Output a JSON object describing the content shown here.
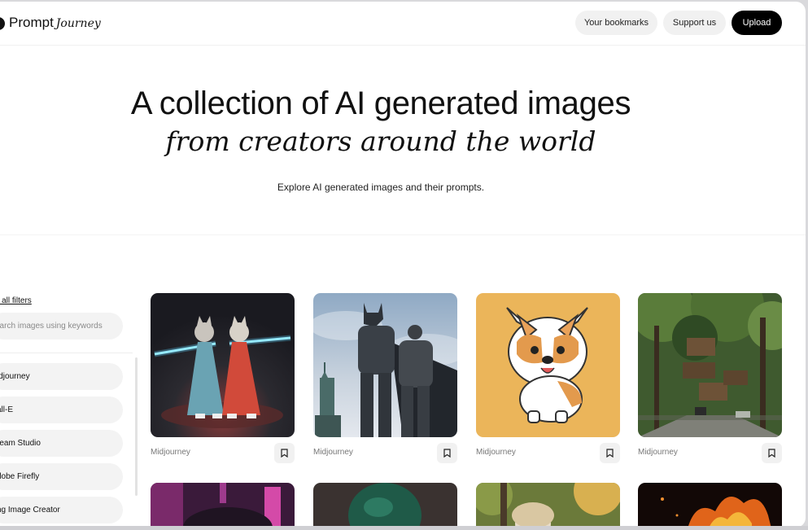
{
  "brand": {
    "name": "Prompt",
    "script": "Journey"
  },
  "nav": {
    "bookmarks": "Your bookmarks",
    "support": "Support us",
    "upload": "Upload"
  },
  "hero": {
    "title": "A collection of AI generated images",
    "subtitle": "from creators around the world",
    "tagline": "Explore AI generated images and their prompts."
  },
  "filters": {
    "clear": "r all filters",
    "search_placeholder": "earch images using keywords",
    "items": [
      {
        "label": "idjourney"
      },
      {
        "label": "all-E"
      },
      {
        "label": "ream Studio"
      },
      {
        "label": "dobe Firefly"
      },
      {
        "label": "ng Image Creator"
      }
    ]
  },
  "cards": [
    {
      "source": "Midjourney",
      "icon": "samurai-cats-image"
    },
    {
      "source": "Midjourney",
      "icon": "batman-statue-image"
    },
    {
      "source": "Midjourney",
      "icon": "corgi-sticker-image"
    },
    {
      "source": "Midjourney",
      "icon": "treehouse-street-image"
    }
  ],
  "colors": {
    "upload_bg": "#000000",
    "pill_bg": "#f1f1f1",
    "corgi_bg": "#ebb55a"
  }
}
